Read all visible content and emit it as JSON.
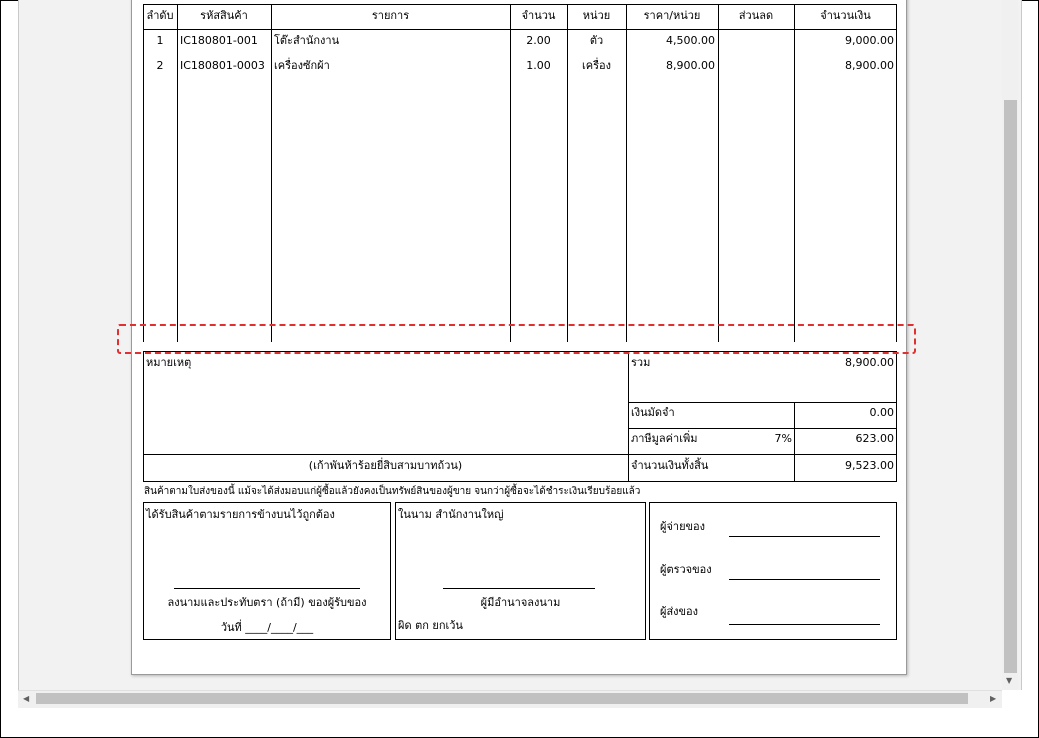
{
  "table": {
    "headers": [
      "ลำดับ",
      "รหัสสินค้า",
      "รายการ",
      "จำนวน",
      "หน่วย",
      "ราคา/หน่วย",
      "ส่วนลด",
      "จำนวนเงิน"
    ],
    "rows": [
      {
        "no": "1",
        "code": "IC180801-001",
        "desc": "โต๊ะสำนักงาน",
        "qty": "2.00",
        "unit": "ตัว",
        "price": "4,500.00",
        "discount": "",
        "amount": "9,000.00"
      },
      {
        "no": "2",
        "code": "IC180801-0003",
        "desc": "เครื่องซักผ้า",
        "qty": "1.00",
        "unit": "เครื่อง",
        "price": "8,900.00",
        "discount": "",
        "amount": "8,900.00"
      }
    ]
  },
  "summary": {
    "remark_label": "หมายเหตุ",
    "total_label": "รวม",
    "total_value": "8,900.00",
    "deposit_label": "เงินมัดจำ",
    "deposit_value": "0.00",
    "vat_label": "ภาษีมูลค่าเพิ่ม",
    "vat_rate": "7%",
    "vat_value": "623.00",
    "amount_words": "(เก้าพันห้าร้อยยี่สิบสามบาทถ้วน)",
    "grand_total_label": "จำนวนเงินทั้งสิ้น",
    "grand_total_value": "9,523.00"
  },
  "note": "สินค้าตามใบส่งของนี้ แม้จะได้ส่งมอบแก่ผู้ซื้อแล้วยังคงเป็นทรัพย์สินของผู้ขาย จนกว่าผู้ซื้อจะได้ชำระเงินเรียบร้อยแล้ว",
  "signatures": {
    "received_title": "ได้รับสินค้าตามรายการข้างบนไว้ถูกต้อง",
    "received_sign": "ลงนามและประทับตรา (ถ้ามี) ของผู้รับของ",
    "received_date": "วันที่   ____/____/___",
    "company_title": "ในนาม สำนักงานใหญ่",
    "company_sign": "ผู้มีอำนาจลงนาม",
    "company_note": "ผิด ตก ยกเว้น",
    "payer": "ผู้จ่ายของ",
    "checker": "ผู้ตรวจของ",
    "sender": "ผู้ส่งของ"
  }
}
